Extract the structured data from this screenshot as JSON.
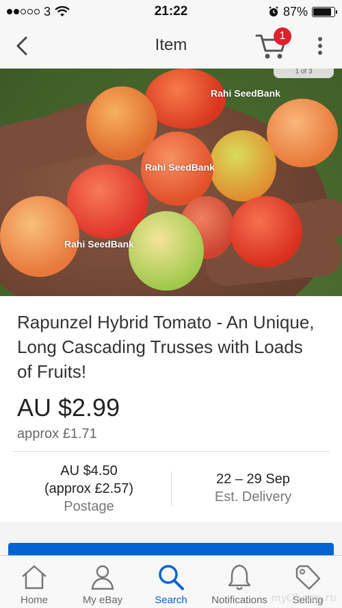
{
  "status_bar": {
    "carrier": "3",
    "time": "21:22",
    "battery": "87%",
    "battery_level": 0.87
  },
  "nav": {
    "title": "Item",
    "cart_count": "1"
  },
  "image": {
    "counter": "1 of 3",
    "watermarks": [
      "Rahi SeedBank",
      "Rahi SeedBank",
      "Rahi SeedBank"
    ]
  },
  "item": {
    "title": "Rapunzel Hybrid Tomato - An Unique, Long Cascading Trusses with Loads of Fruits!",
    "price": "AU $2.99",
    "approx": "approx £1.71",
    "postage_value_line1": "AU $4.50",
    "postage_value_line2": "(approx £2.57)",
    "postage_label": "Postage",
    "delivery_value": "22 – 29 Sep",
    "delivery_label": "Est. Delivery"
  },
  "tabs": [
    {
      "label": "Home",
      "icon": "home-icon"
    },
    {
      "label": "My eBay",
      "icon": "person-icon"
    },
    {
      "label": "Search",
      "icon": "search-icon",
      "active": true
    },
    {
      "label": "Notifications",
      "icon": "bell-icon"
    },
    {
      "label": "Selling",
      "icon": "tag-icon"
    }
  ],
  "watermark": "myCharm.ru",
  "colors": {
    "accent": "#0064d2",
    "badge": "#e0202f"
  }
}
